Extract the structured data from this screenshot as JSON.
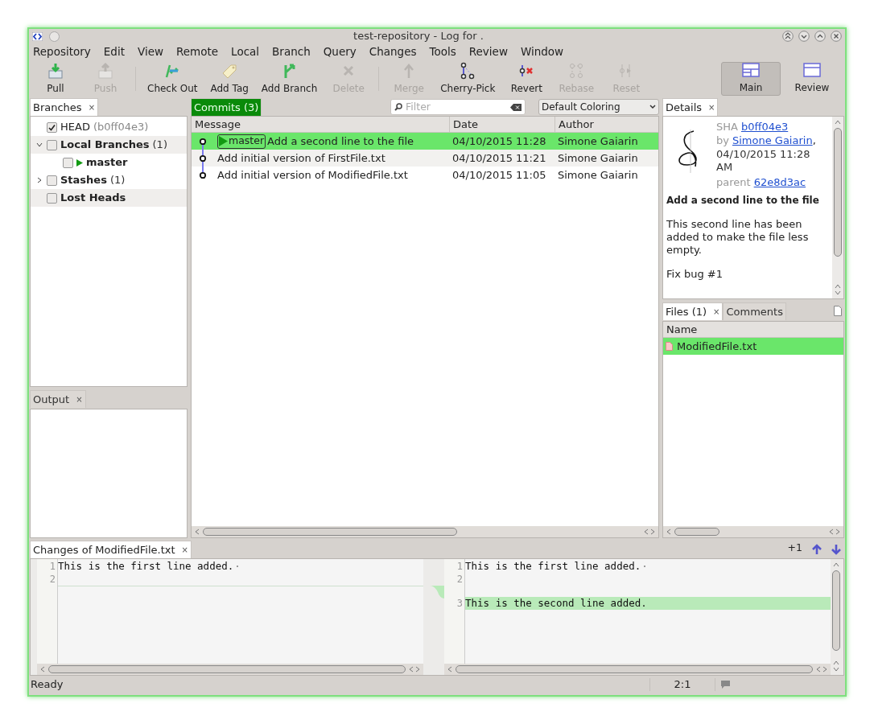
{
  "window": {
    "title": "test-repository - Log for ."
  },
  "menu": [
    "Repository",
    "Edit",
    "View",
    "Remote",
    "Local",
    "Branch",
    "Query",
    "Changes",
    "Tools",
    "Review",
    "Window"
  ],
  "toolbar": [
    {
      "kind": "pull",
      "label": "Pull",
      "disabled": false
    },
    {
      "kind": "push",
      "label": "Push",
      "disabled": true
    },
    {
      "kind": "sep"
    },
    {
      "kind": "checkout",
      "label": "Check Out",
      "disabled": false
    },
    {
      "kind": "tag",
      "label": "Add Tag",
      "disabled": false
    },
    {
      "kind": "branch",
      "label": "Add Branch",
      "disabled": false
    },
    {
      "kind": "delete",
      "label": "Delete",
      "disabled": true
    },
    {
      "kind": "sep"
    },
    {
      "kind": "merge",
      "label": "Merge",
      "disabled": true
    },
    {
      "kind": "cherry",
      "label": "Cherry-Pick",
      "disabled": false
    },
    {
      "kind": "revert",
      "label": "Revert",
      "disabled": false
    },
    {
      "kind": "rebase",
      "label": "Rebase",
      "disabled": true
    },
    {
      "kind": "reset",
      "label": "Reset",
      "disabled": true
    }
  ],
  "views": [
    {
      "kind": "main",
      "label": "Main",
      "selected": true
    },
    {
      "kind": "review",
      "label": "Review",
      "selected": false
    }
  ],
  "branches": {
    "tab": "Branches",
    "close": "×",
    "tree": [
      {
        "label": "HEAD",
        "hint": "(b0ff04e3)",
        "checked": true,
        "bold": false
      },
      {
        "label": "Local Branches",
        "hint": "(1)",
        "checked": false,
        "bold": true,
        "expanded": true,
        "children": [
          {
            "label": "master",
            "checked": false,
            "bold": true,
            "current": true
          }
        ]
      },
      {
        "label": "Stashes",
        "hint": "(1)",
        "checked": false,
        "bold": true,
        "expanded": false
      },
      {
        "label": "Lost Heads",
        "checked": false,
        "bold": true
      }
    ]
  },
  "output": {
    "tab": "Output",
    "close": "×"
  },
  "commits": {
    "tab": "Commits (3)",
    "filter_placeholder": "Filter",
    "coloring": "Default Coloring",
    "columns": [
      "Message",
      "Date",
      "Author"
    ],
    "rows": [
      {
        "ref": "master",
        "message": "Add a second line to the file",
        "date": "04/10/2015 11:28",
        "author": "Simone Gaiarin",
        "selected": true
      },
      {
        "message": "Add initial version of FirstFile.txt",
        "date": "04/10/2015 11:21",
        "author": "Simone Gaiarin",
        "selected": false
      },
      {
        "message": "Add initial version of ModifiedFile.txt",
        "date": "04/10/2015 11:05",
        "author": "Simone Gaiarin",
        "selected": false
      }
    ]
  },
  "details": {
    "tab": "Details",
    "close": "×",
    "sha_label": "SHA",
    "sha": "b0ff04e3",
    "by_label": "by",
    "author": "Simone Gaiarin",
    "comma": ",",
    "date": "04/10/2015 11:28 AM",
    "parent_label": "parent",
    "parent": "62e8d3ac",
    "subject": "Add a second line to the file",
    "body": [
      "This second line has been added to make the file less empty.",
      "Fix bug #1"
    ]
  },
  "files": {
    "tabs": [
      {
        "label": "Files (1)",
        "selected": true,
        "close": "×"
      },
      {
        "label": "Comments",
        "selected": false
      }
    ],
    "column": "Name",
    "rows": [
      {
        "name": "ModifiedFile.txt",
        "selected": true
      }
    ]
  },
  "diff": {
    "tab": "Changes of ModifiedFile.txt",
    "close": "×",
    "count": "+1",
    "left": [
      {
        "number": "1",
        "text": "This is the first line added.",
        "kind": "same"
      },
      {
        "number": "2",
        "kind": "same"
      }
    ],
    "right": [
      {
        "number": "1",
        "text": "This is the first line added.",
        "kind": "same"
      },
      {
        "number": "2",
        "kind": "same"
      },
      {
        "number": "3",
        "text": "This is the second line added.",
        "kind": "added"
      }
    ]
  },
  "status_bar": {
    "message": "Ready",
    "position": "2:1"
  }
}
